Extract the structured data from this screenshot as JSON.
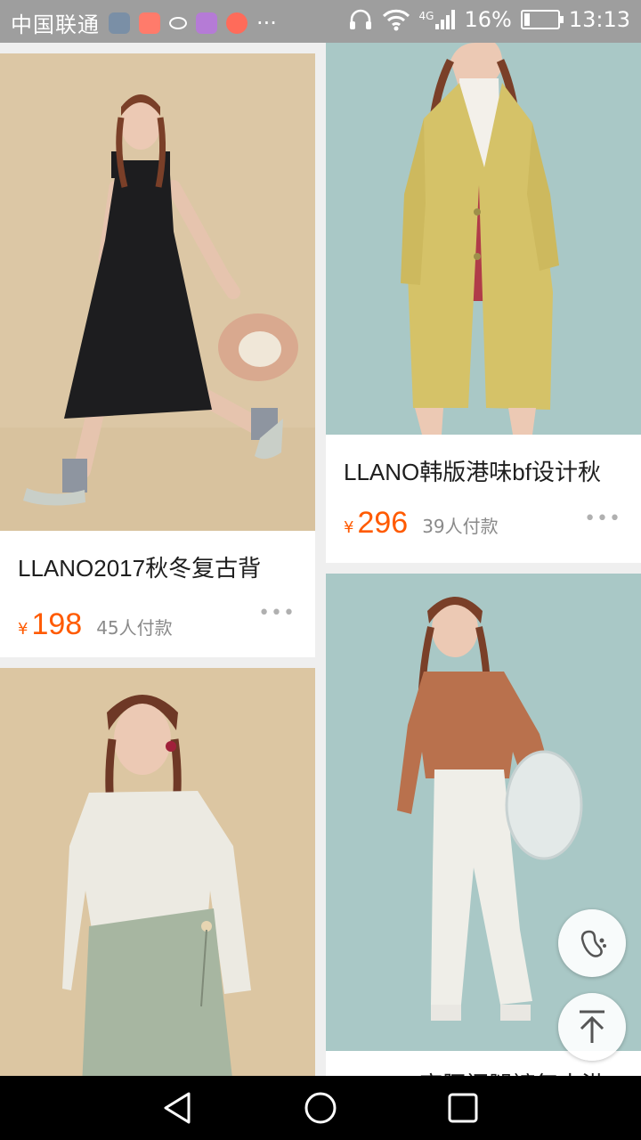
{
  "status_bar": {
    "carrier": "中国联通",
    "network": "4G",
    "battery": "16%",
    "battery_level": 0.16,
    "time": "13:13",
    "app_icon_colors": [
      "#7a8fa6",
      "#ff7b6b",
      "#ffffff",
      "#b57bd6",
      "#ff6b5a"
    ],
    "more_label": "···"
  },
  "products": [
    {
      "title": "LLANO2017秋冬复古背",
      "currency": "¥",
      "price": "198",
      "paid": "45人付款",
      "more": "•••"
    },
    {
      "title": "LLANO韩版港味bf设计秋",
      "currency": "¥",
      "price": "296",
      "paid": "39人付款",
      "more": "•••"
    },
    {
      "title": "",
      "currency": "",
      "price": "",
      "paid": "",
      "more": ""
    },
    {
      "title": "LLANO高腰阔腿裤复古港",
      "currency": "",
      "price": "",
      "paid": "",
      "more": ""
    }
  ],
  "floating": {
    "footprint_icon": "footprint-icon",
    "back_to_top_icon": "arrow-up-to-top-icon"
  },
  "nav": {
    "back_icon": "triangle-back-icon",
    "home_icon": "circle-home-icon",
    "recent_icon": "square-recent-icon"
  },
  "colors": {
    "price": "#ff5a00",
    "status_bar": "#9e9e9e",
    "nav_bar": "#000000"
  }
}
